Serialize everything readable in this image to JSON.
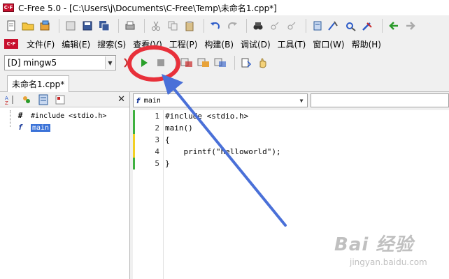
{
  "window": {
    "title": "C-Free 5.0 - [C:\\Users\\j\\Documents\\C-Free\\Temp\\未命名1.cpp*]",
    "logo_text": "C·F"
  },
  "menu": {
    "logo_text": "C·F",
    "items": [
      "文件(F)",
      "编辑(E)",
      "搜索(S)",
      "查看(V)",
      "工程(P)",
      "构建(B)",
      "调试(D)",
      "工具(T)",
      "窗口(W)",
      "帮助(H)"
    ]
  },
  "toolbar2": {
    "compiler": "[D] mingw5"
  },
  "tabs": [
    {
      "label": "未命名1.cpp*"
    }
  ],
  "left_panel": {
    "close_label": "✕",
    "tree": [
      {
        "glyph": "#",
        "text": "#include <stdio.h>",
        "selected": false
      },
      {
        "glyph": "f",
        "text": "main",
        "selected": true
      }
    ]
  },
  "editor_head": {
    "function": "main",
    "function_icon": "f"
  },
  "editor": {
    "lines": [
      {
        "num": "1",
        "code": "#include <stdio.h>"
      },
      {
        "num": "2",
        "code": "main()"
      },
      {
        "num": "3",
        "code": "{"
      },
      {
        "num": "4",
        "code": "    printf(\"helloworld\");"
      },
      {
        "num": "5",
        "code": "}"
      }
    ]
  },
  "colors": {
    "highlight": "#e8303a",
    "arrow": "#4a70d8",
    "marker_green": "#3fb13f",
    "marker_yellow": "#f2d024",
    "selection": "#3a72d8"
  },
  "watermark": {
    "main": "Bai 经验",
    "sub": "jingyan.baidu.com"
  }
}
